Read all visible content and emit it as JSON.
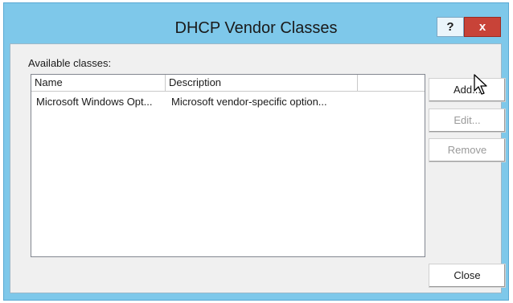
{
  "window": {
    "title": "DHCP Vendor Classes",
    "help_label": "?",
    "close_label": "x"
  },
  "main": {
    "available_label": "Available classes:",
    "columns": [
      "Name",
      "Description",
      ""
    ],
    "rows": [
      {
        "name": "Microsoft Windows Opt...",
        "description": "Microsoft vendor-specific option..."
      }
    ]
  },
  "buttons": {
    "add": "Add...",
    "edit": "Edit...",
    "remove": "Remove",
    "close": "Close"
  },
  "colors": {
    "title_bar": "#7ec8ea",
    "close_button": "#c84338",
    "client_bg": "#f0f0f0"
  },
  "icons": {
    "cursor": "mouse-pointer-icon"
  }
}
